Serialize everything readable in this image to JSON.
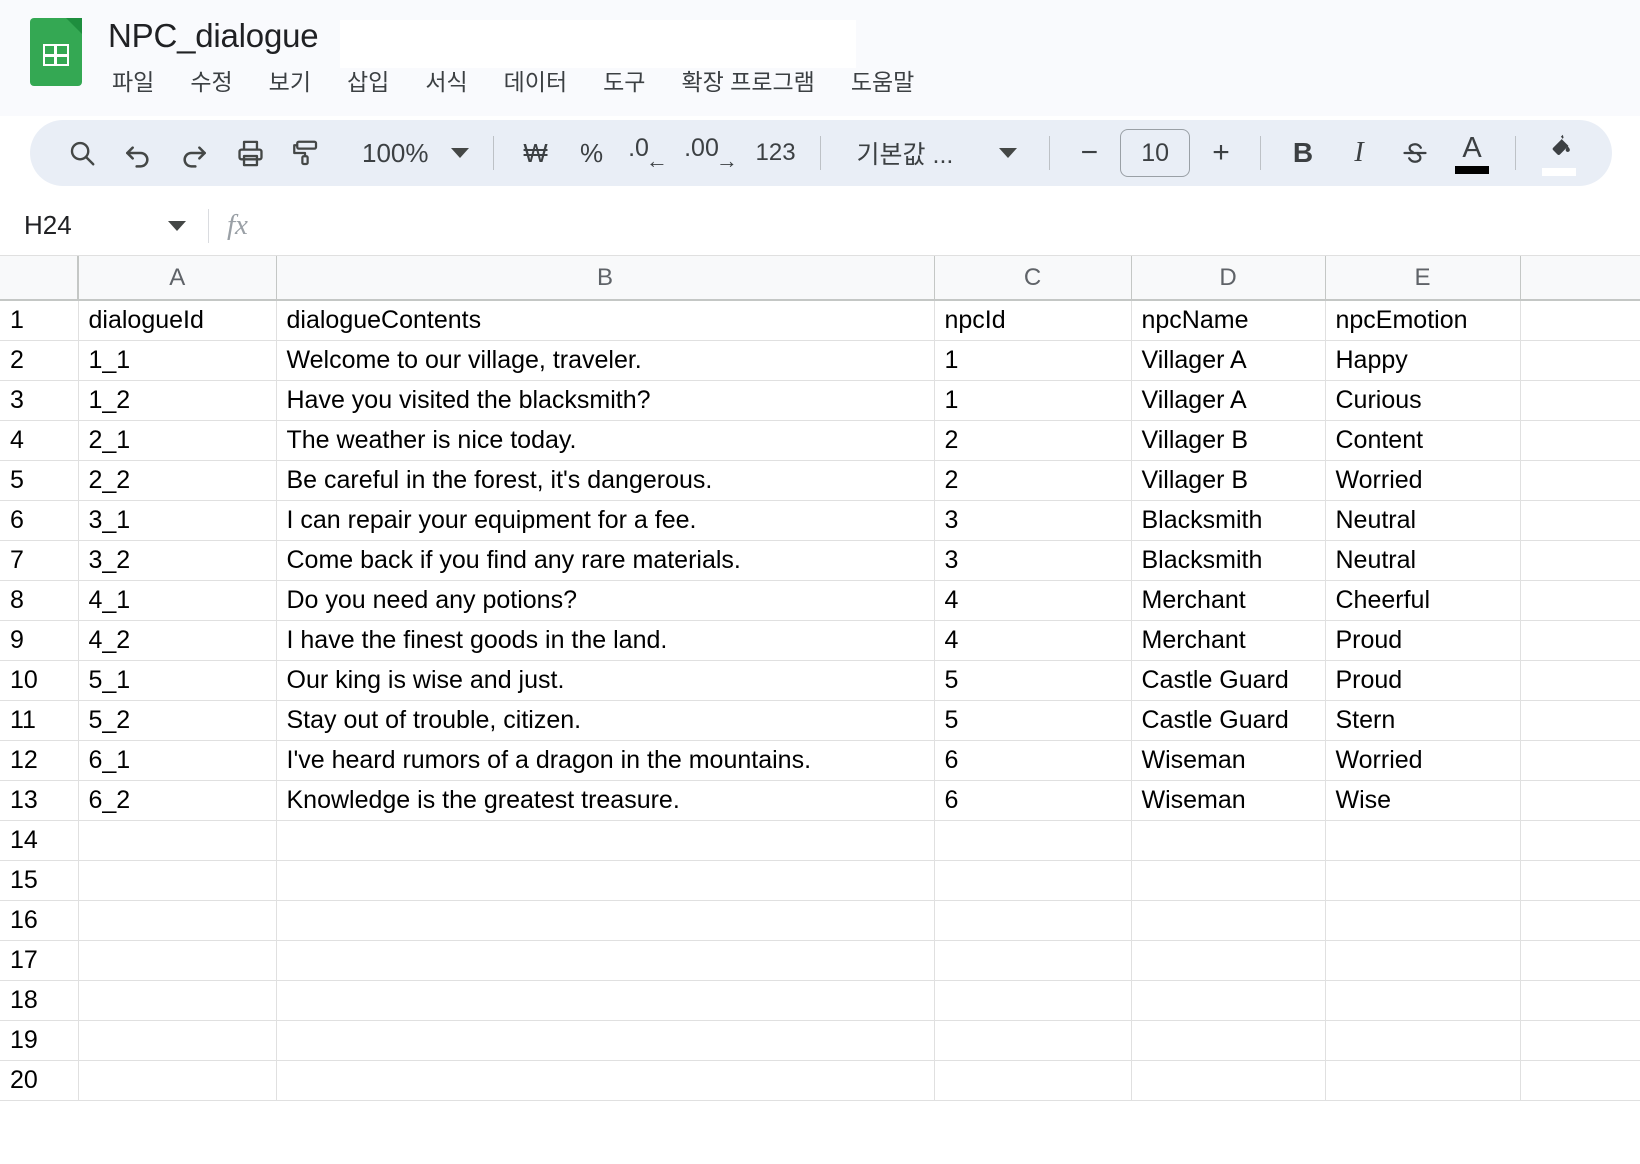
{
  "app": {
    "doc_title": "NPC_dialogue",
    "logo_name": "google-sheets-logo",
    "menus": [
      "파일",
      "수정",
      "보기",
      "삽입",
      "서식",
      "데이터",
      "도구",
      "확장 프로그램",
      "도움말"
    ]
  },
  "toolbar": {
    "search_icon": "search-icon",
    "undo_icon": "undo-icon",
    "redo_icon": "redo-icon",
    "print_icon": "print-icon",
    "paint_format_icon": "paint-format-icon",
    "zoom_level": "100%",
    "currency_label": "₩",
    "percent_label": "%",
    "decrease_decimal_label": ".0",
    "increase_decimal_label": ".00",
    "number_format_label": "123",
    "font_family": "기본값 ...",
    "decrease_font_label": "−",
    "font_size": "10",
    "increase_font_label": "+",
    "bold_label": "B",
    "italic_label": "I",
    "strikethrough_label": "S",
    "text_color_label": "A",
    "text_color_swatch": "#000000",
    "fill_color_icon": "fill-color-icon",
    "fill_color_swatch": "#ffffff"
  },
  "formula_bar": {
    "name_box_value": "H24",
    "fx_label": "fx",
    "formula_value": "",
    "formula_placeholder": ""
  },
  "grid": {
    "column_headers": [
      "A",
      "B",
      "C",
      "D",
      "E",
      ""
    ],
    "row_numbers": [
      1,
      2,
      3,
      4,
      5,
      6,
      7,
      8,
      9,
      10,
      11,
      12,
      13,
      14,
      15,
      16,
      17,
      18,
      19,
      20
    ],
    "header_row": {
      "A": "dialogueId",
      "B": "dialogueContents",
      "C": "npcId",
      "D": "npcName",
      "E": "npcEmotion"
    },
    "rows": [
      {
        "A": "1_1",
        "B": "Welcome to our village, traveler.",
        "C": "1",
        "D": "Villager A",
        "E": "Happy"
      },
      {
        "A": "1_2",
        "B": "Have you visited the blacksmith?",
        "C": "1",
        "D": "Villager A",
        "E": "Curious"
      },
      {
        "A": "2_1",
        "B": "The weather is nice today.",
        "C": "2",
        "D": "Villager B",
        "E": "Content"
      },
      {
        "A": "2_2",
        "B": "Be careful in the forest, it's dangerous.",
        "C": "2",
        "D": "Villager B",
        "E": "Worried"
      },
      {
        "A": "3_1",
        "B": "I can repair your equipment for a fee.",
        "C": "3",
        "D": "Blacksmith",
        "E": "Neutral"
      },
      {
        "A": "3_2",
        "B": "Come back if you find any rare materials.",
        "C": "3",
        "D": "Blacksmith",
        "E": "Neutral"
      },
      {
        "A": "4_1",
        "B": "Do you need any potions?",
        "C": "4",
        "D": "Merchant",
        "E": "Cheerful"
      },
      {
        "A": "4_2",
        "B": "I have the finest goods in the land.",
        "C": "4",
        "D": "Merchant",
        "E": "Proud"
      },
      {
        "A": "5_1",
        "B": "Our king is wise and just.",
        "C": "5",
        "D": "Castle Guard",
        "E": "Proud"
      },
      {
        "A": "5_2",
        "B": "Stay out of trouble, citizen.",
        "C": "5",
        "D": "Castle Guard",
        "E": "Stern"
      },
      {
        "A": "6_1",
        "B": "I've heard rumors of a dragon in the mountains.",
        "C": "6",
        "D": "Wiseman",
        "E": "Worried"
      },
      {
        "A": "6_2",
        "B": "Knowledge is the greatest treasure.",
        "C": "6",
        "D": "Wiseman",
        "E": "Wise"
      },
      {
        "A": "",
        "B": "",
        "C": "",
        "D": "",
        "E": ""
      },
      {
        "A": "",
        "B": "",
        "C": "",
        "D": "",
        "E": ""
      },
      {
        "A": "",
        "B": "",
        "C": "",
        "D": "",
        "E": ""
      },
      {
        "A": "",
        "B": "",
        "C": "",
        "D": "",
        "E": ""
      },
      {
        "A": "",
        "B": "",
        "C": "",
        "D": "",
        "E": ""
      },
      {
        "A": "",
        "B": "",
        "C": "",
        "D": "",
        "E": ""
      },
      {
        "A": "",
        "B": "",
        "C": "",
        "D": "",
        "E": ""
      }
    ]
  },
  "colors": {
    "brand_green": "#34a853",
    "header_bg": "#f9fafd",
    "toolbar_bg": "#e9eef6",
    "grid_line": "#e0e0e0",
    "header_text": "#5f6368"
  }
}
